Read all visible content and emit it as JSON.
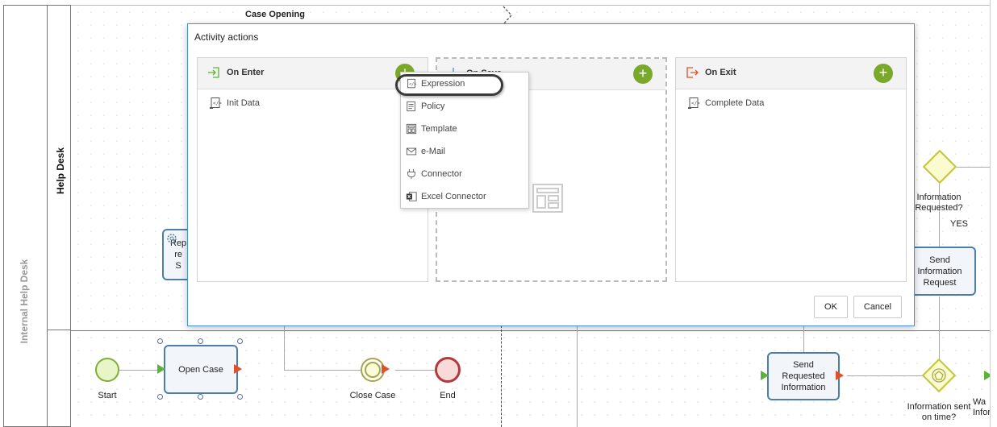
{
  "diagram": {
    "pool_label": "Internal Help Desk",
    "lane_label": "Help Desk",
    "phase_title": "Case Opening",
    "shapes": {
      "start": "Start",
      "open_case": "Open Case",
      "close_case": "Close Case",
      "end": "End",
      "send_requested_information": "Send Requested Information",
      "information_sent_on_time": "Information sent on time?",
      "information_requested": "Information Requested?",
      "yes_label": "YES",
      "send_information_request": "Send Information Request",
      "partial_task_left": "Rep\nre\nS",
      "partial_wait_label": "Wa\nInfor"
    }
  },
  "dialog": {
    "title": "Activity actions",
    "panels": [
      {
        "title": "On Enter",
        "items": [
          "Init Data"
        ]
      },
      {
        "title": "On Save",
        "items": []
      },
      {
        "title": "On Exit",
        "items": [
          "Complete Data"
        ]
      }
    ],
    "add_icon": "+",
    "ok_label": "OK",
    "cancel_label": "Cancel"
  },
  "add_menu": {
    "items": [
      {
        "label": "Expression",
        "icon": "expression-icon"
      },
      {
        "label": "Policy",
        "icon": "policy-icon"
      },
      {
        "label": "Template",
        "icon": "template-icon"
      },
      {
        "label": "e-Mail",
        "icon": "email-icon"
      },
      {
        "label": "Connector",
        "icon": "connector-icon"
      },
      {
        "label": "Excel Connector",
        "icon": "excel-connector-icon"
      }
    ],
    "highlighted": "Expression"
  },
  "colors": {
    "accent_green": "#7aa82a",
    "dialog_border": "#4a90d9",
    "task_border": "#4d7ea8",
    "end_event": "#c0392b",
    "start_event": "#8bc34a"
  }
}
